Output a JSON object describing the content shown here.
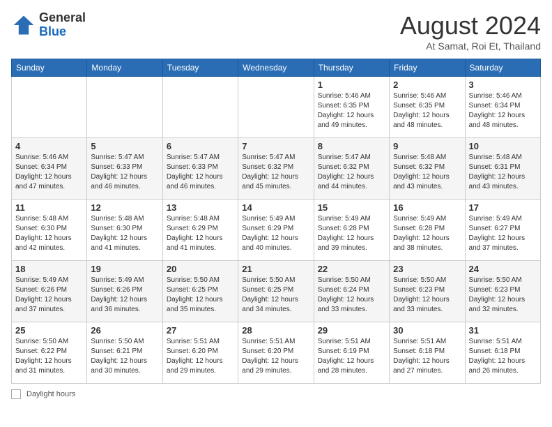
{
  "header": {
    "logo_general": "General",
    "logo_blue": "Blue",
    "month_year": "August 2024",
    "location": "At Samat, Roi Et, Thailand"
  },
  "days_of_week": [
    "Sunday",
    "Monday",
    "Tuesday",
    "Wednesday",
    "Thursday",
    "Friday",
    "Saturday"
  ],
  "weeks": [
    [
      {
        "day": "",
        "info": ""
      },
      {
        "day": "",
        "info": ""
      },
      {
        "day": "",
        "info": ""
      },
      {
        "day": "",
        "info": ""
      },
      {
        "day": "1",
        "info": "Sunrise: 5:46 AM\nSunset: 6:35 PM\nDaylight: 12 hours and 49 minutes."
      },
      {
        "day": "2",
        "info": "Sunrise: 5:46 AM\nSunset: 6:35 PM\nDaylight: 12 hours and 48 minutes."
      },
      {
        "day": "3",
        "info": "Sunrise: 5:46 AM\nSunset: 6:34 PM\nDaylight: 12 hours and 48 minutes."
      }
    ],
    [
      {
        "day": "4",
        "info": "Sunrise: 5:46 AM\nSunset: 6:34 PM\nDaylight: 12 hours and 47 minutes."
      },
      {
        "day": "5",
        "info": "Sunrise: 5:47 AM\nSunset: 6:33 PM\nDaylight: 12 hours and 46 minutes."
      },
      {
        "day": "6",
        "info": "Sunrise: 5:47 AM\nSunset: 6:33 PM\nDaylight: 12 hours and 46 minutes."
      },
      {
        "day": "7",
        "info": "Sunrise: 5:47 AM\nSunset: 6:32 PM\nDaylight: 12 hours and 45 minutes."
      },
      {
        "day": "8",
        "info": "Sunrise: 5:47 AM\nSunset: 6:32 PM\nDaylight: 12 hours and 44 minutes."
      },
      {
        "day": "9",
        "info": "Sunrise: 5:48 AM\nSunset: 6:32 PM\nDaylight: 12 hours and 43 minutes."
      },
      {
        "day": "10",
        "info": "Sunrise: 5:48 AM\nSunset: 6:31 PM\nDaylight: 12 hours and 43 minutes."
      }
    ],
    [
      {
        "day": "11",
        "info": "Sunrise: 5:48 AM\nSunset: 6:30 PM\nDaylight: 12 hours and 42 minutes."
      },
      {
        "day": "12",
        "info": "Sunrise: 5:48 AM\nSunset: 6:30 PM\nDaylight: 12 hours and 41 minutes."
      },
      {
        "day": "13",
        "info": "Sunrise: 5:48 AM\nSunset: 6:29 PM\nDaylight: 12 hours and 41 minutes."
      },
      {
        "day": "14",
        "info": "Sunrise: 5:49 AM\nSunset: 6:29 PM\nDaylight: 12 hours and 40 minutes."
      },
      {
        "day": "15",
        "info": "Sunrise: 5:49 AM\nSunset: 6:28 PM\nDaylight: 12 hours and 39 minutes."
      },
      {
        "day": "16",
        "info": "Sunrise: 5:49 AM\nSunset: 6:28 PM\nDaylight: 12 hours and 38 minutes."
      },
      {
        "day": "17",
        "info": "Sunrise: 5:49 AM\nSunset: 6:27 PM\nDaylight: 12 hours and 37 minutes."
      }
    ],
    [
      {
        "day": "18",
        "info": "Sunrise: 5:49 AM\nSunset: 6:26 PM\nDaylight: 12 hours and 37 minutes."
      },
      {
        "day": "19",
        "info": "Sunrise: 5:49 AM\nSunset: 6:26 PM\nDaylight: 12 hours and 36 minutes."
      },
      {
        "day": "20",
        "info": "Sunrise: 5:50 AM\nSunset: 6:25 PM\nDaylight: 12 hours and 35 minutes."
      },
      {
        "day": "21",
        "info": "Sunrise: 5:50 AM\nSunset: 6:25 PM\nDaylight: 12 hours and 34 minutes."
      },
      {
        "day": "22",
        "info": "Sunrise: 5:50 AM\nSunset: 6:24 PM\nDaylight: 12 hours and 33 minutes."
      },
      {
        "day": "23",
        "info": "Sunrise: 5:50 AM\nSunset: 6:23 PM\nDaylight: 12 hours and 33 minutes."
      },
      {
        "day": "24",
        "info": "Sunrise: 5:50 AM\nSunset: 6:23 PM\nDaylight: 12 hours and 32 minutes."
      }
    ],
    [
      {
        "day": "25",
        "info": "Sunrise: 5:50 AM\nSunset: 6:22 PM\nDaylight: 12 hours and 31 minutes."
      },
      {
        "day": "26",
        "info": "Sunrise: 5:50 AM\nSunset: 6:21 PM\nDaylight: 12 hours and 30 minutes."
      },
      {
        "day": "27",
        "info": "Sunrise: 5:51 AM\nSunset: 6:20 PM\nDaylight: 12 hours and 29 minutes."
      },
      {
        "day": "28",
        "info": "Sunrise: 5:51 AM\nSunset: 6:20 PM\nDaylight: 12 hours and 29 minutes."
      },
      {
        "day": "29",
        "info": "Sunrise: 5:51 AM\nSunset: 6:19 PM\nDaylight: 12 hours and 28 minutes."
      },
      {
        "day": "30",
        "info": "Sunrise: 5:51 AM\nSunset: 6:18 PM\nDaylight: 12 hours and 27 minutes."
      },
      {
        "day": "31",
        "info": "Sunrise: 5:51 AM\nSunset: 6:18 PM\nDaylight: 12 hours and 26 minutes."
      }
    ]
  ],
  "footer": {
    "daylight_label": "Daylight hours"
  }
}
